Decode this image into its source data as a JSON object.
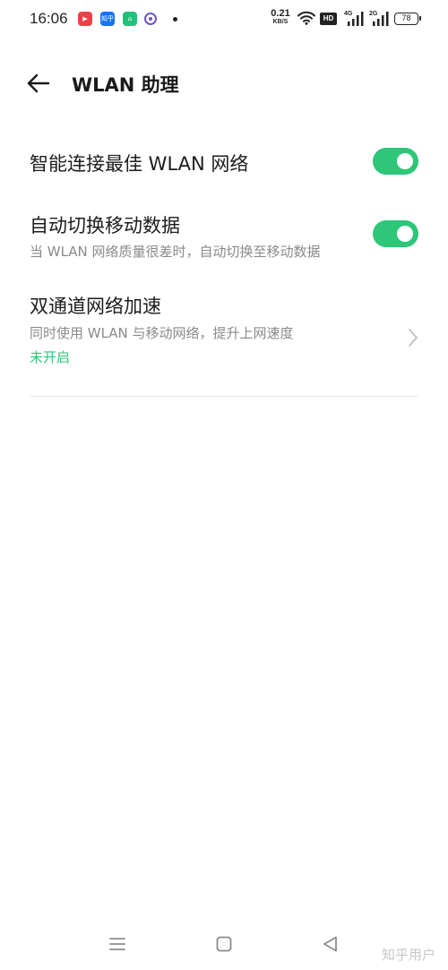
{
  "status_bar": {
    "time": "16:06",
    "app_icons": [
      "video-app-icon",
      "zhihu-app-icon",
      "store-app-icon",
      "browser-app-icon"
    ],
    "zhihu_icon_text": "知乎",
    "net_speed_value": "0.21",
    "net_speed_unit": "KB/S",
    "hd_label": "HD",
    "signal1_label": "4G",
    "signal2_label": "2G",
    "battery": "78"
  },
  "header": {
    "title": "WLAN 助理"
  },
  "settings": {
    "smart_connect": {
      "title": "智能连接最佳 WLAN 网络",
      "enabled": true
    },
    "auto_switch": {
      "title": "自动切换移动数据",
      "subtitle": "当 WLAN 网络质量很差时，自动切换至移动数据",
      "enabled": true
    },
    "dual_channel": {
      "title": "双通道网络加速",
      "subtitle": "同时使用 WLAN 与移动网络，提升上网速度",
      "status": "未开启"
    }
  },
  "watermark": "知乎用户",
  "colors": {
    "accent": "#2ec677",
    "background": "#ffffff",
    "secondary_text": "#8a8a8a"
  }
}
